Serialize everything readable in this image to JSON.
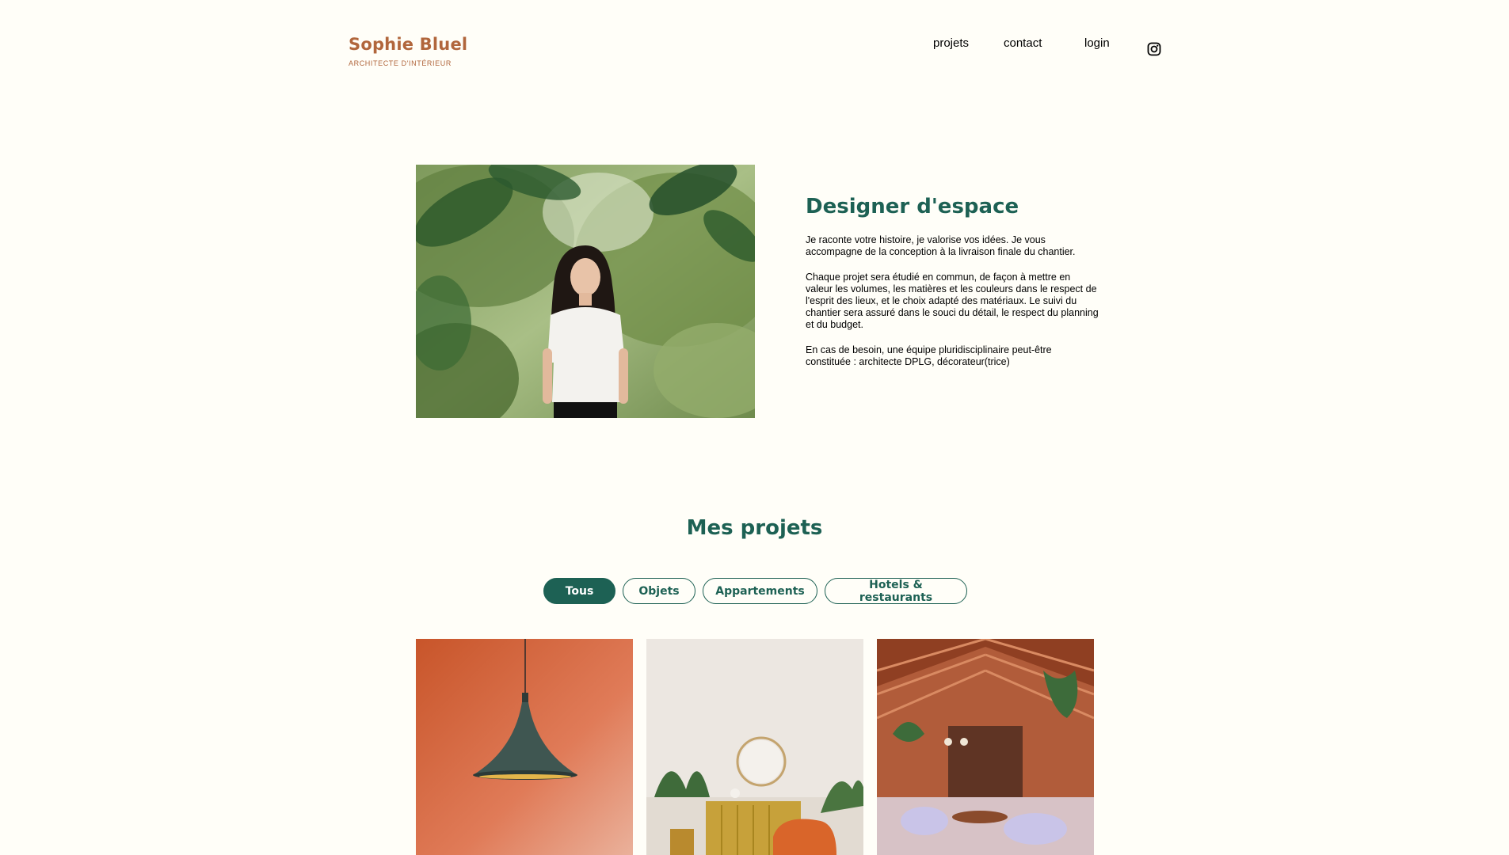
{
  "header": {
    "logo_title": "Sophie Bluel",
    "logo_subtitle": "ARCHITECTE D'INTÉRIEUR",
    "nav": {
      "projets": "projets",
      "contact": "contact",
      "login": "login",
      "instagram_icon": "instagram-icon"
    }
  },
  "intro": {
    "title": "Designer d'espace",
    "paragraphs": [
      "Je raconte votre histoire, je valorise vos idées. Je vous accompagne de la conception à la livraison finale du chantier.",
      "Chaque projet sera étudié en commun, de façon à mettre en valeur les volumes, les matières et les couleurs dans le respect de l'esprit des lieux, et le choix adapté des matériaux. Le suivi du chantier sera assuré dans le souci du détail, le respect du planning et du budget.",
      "En cas de besoin, une équipe pluridisciplinaire peut-être constituée : architecte DPLG, décorateur(trice)"
    ]
  },
  "projects": {
    "title": "Mes projets",
    "filters": [
      "Tous",
      "Objets",
      "Appartements",
      "Hotels & restaurants"
    ],
    "active_filter": "Tous"
  },
  "colors": {
    "brand_orange": "#B1663C",
    "brand_green": "#1D6154",
    "background": "#FFFEF8"
  }
}
